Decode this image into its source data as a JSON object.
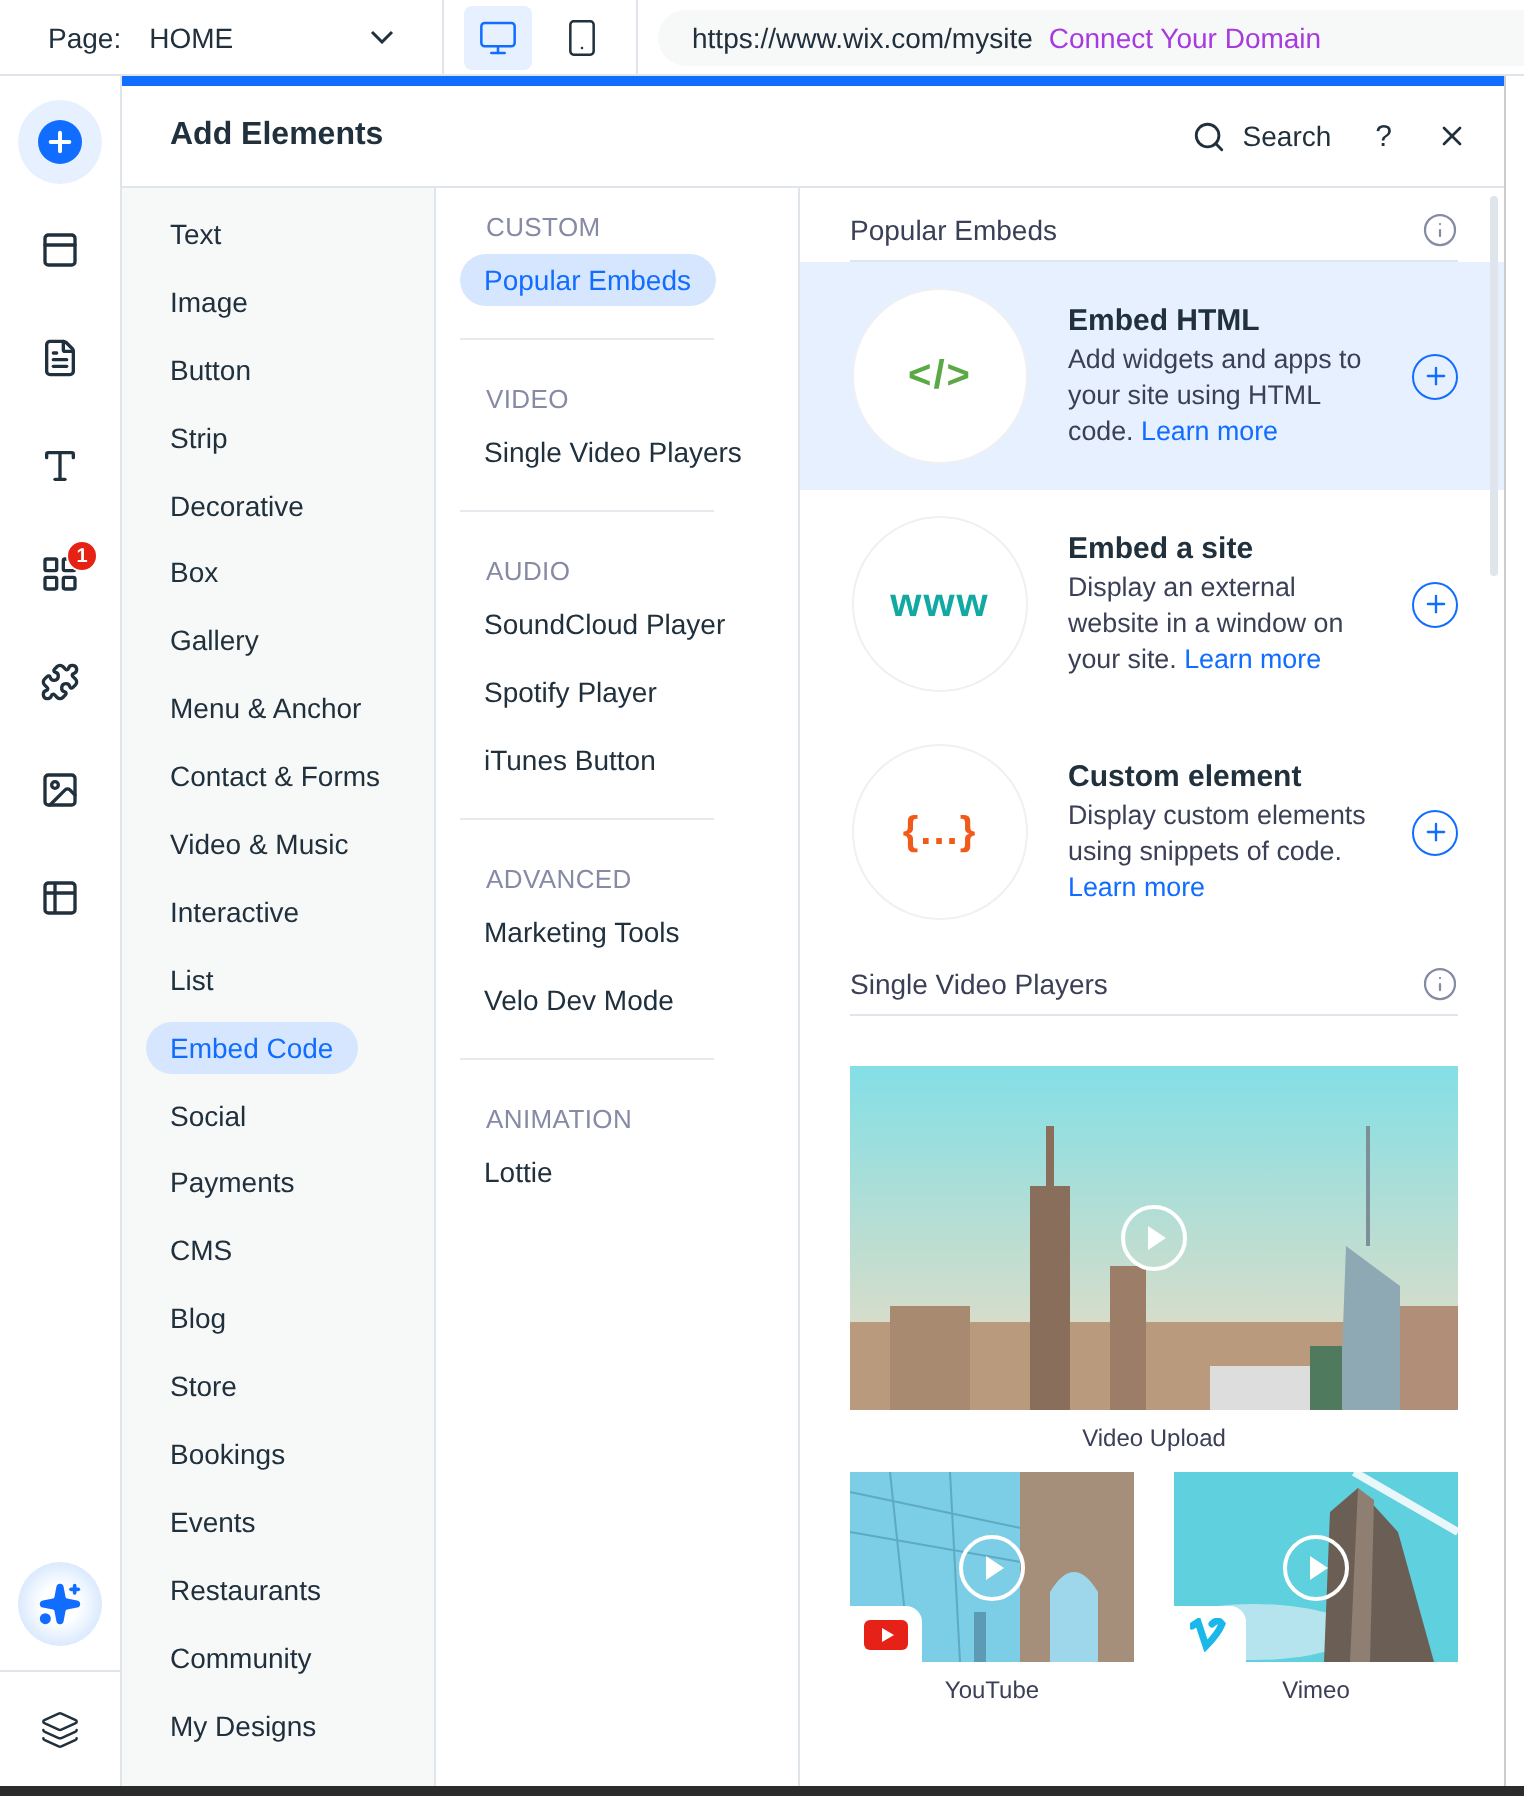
{
  "top_bar": {
    "page_label": "Page:",
    "page": "HOME",
    "devices": [
      {
        "kind": "desktop",
        "selected": true
      },
      {
        "kind": "mobile",
        "selected": false
      }
    ],
    "url": "https://www.wix.com/mysite",
    "domain_link": "Connect Your Domain"
  },
  "rail": {
    "items": [
      {
        "kind": "add",
        "selected": true
      },
      {
        "kind": "sections",
        "selected": false
      },
      {
        "kind": "pages",
        "selected": false
      },
      {
        "kind": "design",
        "selected": false
      },
      {
        "kind": "apps",
        "selected": false,
        "badge": "1"
      },
      {
        "kind": "business",
        "selected": false
      },
      {
        "kind": "media",
        "selected": false
      },
      {
        "kind": "cms",
        "selected": false
      }
    ],
    "bottom": [
      {
        "kind": "ai"
      },
      {
        "kind": "layers"
      }
    ]
  },
  "panel": {
    "title": "Add Elements",
    "search": "Search",
    "help": "?",
    "categories": [
      {
        "label": "Text",
        "selected": false
      },
      {
        "label": "Image",
        "selected": false
      },
      {
        "label": "Button",
        "selected": false
      },
      {
        "label": "Strip",
        "selected": false
      },
      {
        "label": "Decorative",
        "selected": false
      },
      {
        "label": "Box",
        "selected": false
      },
      {
        "label": "Gallery",
        "selected": false
      },
      {
        "label": "Menu & Anchor",
        "selected": false
      },
      {
        "label": "Contact & Forms",
        "selected": false
      },
      {
        "label": "Video & Music",
        "selected": false
      },
      {
        "label": "Interactive",
        "selected": false
      },
      {
        "label": "List",
        "selected": false
      },
      {
        "label": "Embed Code",
        "selected": true
      },
      {
        "label": "Social",
        "selected": false
      },
      {
        "label": "Payments",
        "selected": false
      },
      {
        "label": "CMS",
        "selected": false
      },
      {
        "label": "Blog",
        "selected": false
      },
      {
        "label": "Store",
        "selected": false
      },
      {
        "label": "Bookings",
        "selected": false
      },
      {
        "label": "Events",
        "selected": false
      },
      {
        "label": "Restaurants",
        "selected": false
      },
      {
        "label": "Community",
        "selected": false
      },
      {
        "label": "My Designs",
        "selected": false
      }
    ],
    "sections": [
      {
        "heading": "CUSTOM",
        "items": [
          {
            "label": "Popular Embeds",
            "selected": true
          }
        ]
      },
      {
        "heading": "VIDEO",
        "items": [
          {
            "label": "Single Video Players",
            "selected": false
          }
        ]
      },
      {
        "heading": "AUDIO",
        "items": [
          {
            "label": "SoundCloud Player",
            "selected": false
          },
          {
            "label": "Spotify Player",
            "selected": false
          },
          {
            "label": "iTunes Button",
            "selected": false
          }
        ]
      },
      {
        "heading": "ADVANCED",
        "items": [
          {
            "label": "Marketing Tools",
            "selected": false
          },
          {
            "label": "Velo Dev Mode",
            "selected": false
          }
        ]
      },
      {
        "heading": "ANIMATION",
        "items": [
          {
            "label": "Lottie",
            "selected": false
          }
        ]
      }
    ],
    "popular": {
      "heading": "Popular Embeds",
      "items": [
        {
          "kind": "html",
          "title": "Embed HTML",
          "description": "Add widgets and apps to your site using HTML code.",
          "link": "Learn more",
          "highlighted": true,
          "glyph": "</>"
        },
        {
          "kind": "site",
          "title": "Embed a site",
          "description": "Display an external website in a window on your site.",
          "link": "Learn more",
          "highlighted": false,
          "glyph": "www"
        },
        {
          "kind": "custom",
          "title": "Custom element",
          "description": "Display custom elements using snippets of code.",
          "link": "Learn more",
          "highlighted": false,
          "glyph": "{...}"
        }
      ]
    },
    "videos": {
      "heading": "Single Video Players",
      "items": [
        {
          "kind": "upload",
          "label": "Video Upload"
        },
        {
          "kind": "youtube",
          "label": "YouTube"
        },
        {
          "kind": "vimeo",
          "label": "Vimeo"
        }
      ]
    }
  }
}
